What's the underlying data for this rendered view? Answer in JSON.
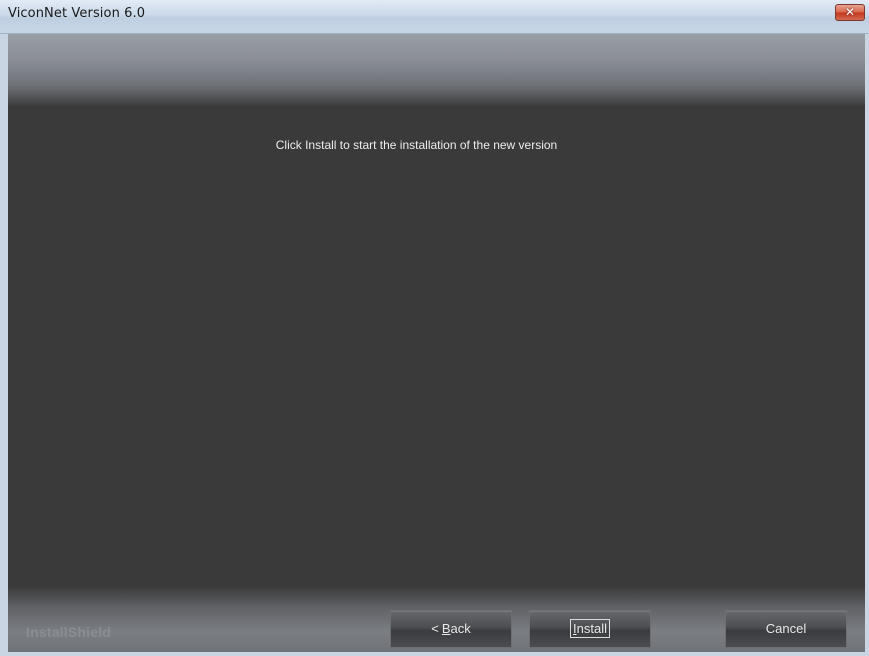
{
  "window": {
    "title": "ViconNet Version 6.0"
  },
  "content": {
    "instruction": "Click Install to start the installation of the new version"
  },
  "footer": {
    "brand": "InstallShield",
    "buttons": {
      "back_arrow": "<",
      "back_mnemonic": "B",
      "back_rest": "ack",
      "install_mnemonic": "I",
      "install_rest": "nstall",
      "cancel": "Cancel"
    }
  },
  "icons": {
    "close": "close-icon"
  },
  "colors": {
    "panel_background": "#3a3a3a",
    "title_bar": "#c9d5e3",
    "close_button": "#d04a33",
    "text": "#ececec"
  }
}
